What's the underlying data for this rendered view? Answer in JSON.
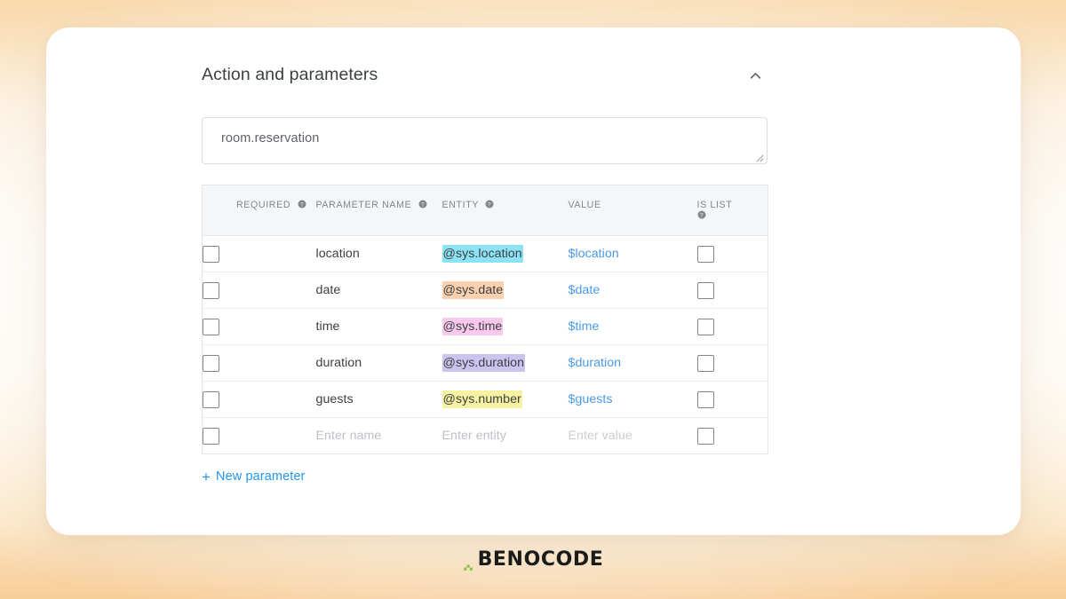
{
  "panel": {
    "title": "Action and parameters",
    "collapse_icon": "chevron-up-icon",
    "action": {
      "value": "room.reservation",
      "resize_handle": "resize-grip-icon"
    },
    "new_parameter_label": "New parameter",
    "new_parameter_plus": "+"
  },
  "table": {
    "columns": [
      {
        "label": "REQUIRED",
        "help": true
      },
      {
        "label": "PARAMETER NAME",
        "help": true
      },
      {
        "label": "ENTITY",
        "help": true
      },
      {
        "label": "VALUE",
        "help": false
      },
      {
        "label": "IS LIST",
        "help": true
      }
    ],
    "rows": [
      {
        "required": false,
        "name": "location",
        "entity": "@sys.location",
        "entity_color": "#8ce3f5",
        "value": "$location",
        "is_list": false
      },
      {
        "required": false,
        "name": "date",
        "entity": "@sys.date",
        "entity_color": "#fbd0ae",
        "value": "$date",
        "is_list": false
      },
      {
        "required": false,
        "name": "time",
        "entity": "@sys.time",
        "entity_color": "#f7c9ec",
        "value": "$time",
        "is_list": false
      },
      {
        "required": false,
        "name": "duration",
        "entity": "@sys.duration",
        "entity_color": "#ccc3ef",
        "value": "$duration",
        "is_list": false
      },
      {
        "required": false,
        "name": "guests",
        "entity": "@sys.number",
        "entity_color": "#f5f3a1",
        "value": "$guests",
        "is_list": false
      }
    ],
    "new_row": {
      "name_placeholder": "Enter name",
      "entity_placeholder": "Enter entity",
      "value_placeholder": "Enter value"
    }
  },
  "footer": {
    "logo_text": "BENOCODE",
    "logo_mark_color": "#8bc34a"
  },
  "theme": {
    "link_blue": "#2196f3",
    "value_blue": "#4a9ae8",
    "text_dark": "#3c4043",
    "text_muted": "#80868b"
  }
}
